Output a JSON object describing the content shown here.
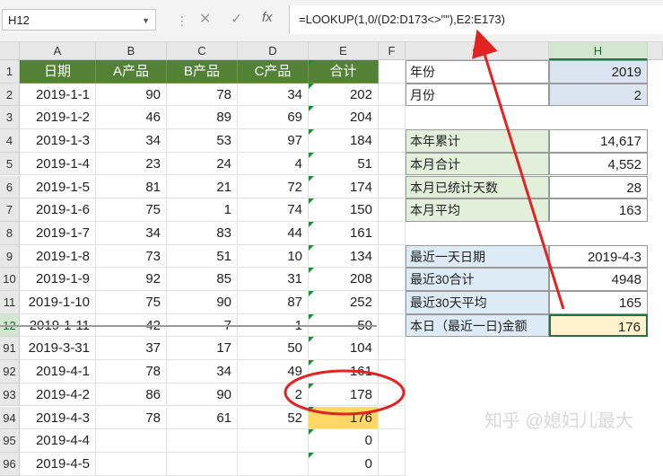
{
  "formula_bar": {
    "name_box": "H12",
    "cancel_icon": "cancel-x-icon",
    "confirm_icon": "confirm-check-icon",
    "function_label": "fx",
    "formula": "=LOOKUP(1,0/(D2:D173<>\"\"),E2:E173)"
  },
  "columns": [
    "A",
    "B",
    "C",
    "D",
    "E",
    "F",
    "G",
    "H"
  ],
  "header_row": [
    "日期",
    "A产品",
    "B产品",
    "C产品",
    "合计"
  ],
  "rows": [
    {
      "n": "1"
    },
    {
      "n": "2",
      "date": "2019-1-1",
      "a": "90",
      "b": "78",
      "c": "34",
      "t": "202"
    },
    {
      "n": "3",
      "date": "2019-1-2",
      "a": "46",
      "b": "89",
      "c": "69",
      "t": "204"
    },
    {
      "n": "4",
      "date": "2019-1-3",
      "a": "34",
      "b": "53",
      "c": "97",
      "t": "184"
    },
    {
      "n": "5",
      "date": "2019-1-4",
      "a": "23",
      "b": "24",
      "c": "4",
      "t": "51"
    },
    {
      "n": "6",
      "date": "2019-1-5",
      "a": "81",
      "b": "21",
      "c": "72",
      "t": "174"
    },
    {
      "n": "7",
      "date": "2019-1-6",
      "a": "75",
      "b": "1",
      "c": "74",
      "t": "150"
    },
    {
      "n": "8",
      "date": "2019-1-7",
      "a": "34",
      "b": "83",
      "c": "44",
      "t": "161"
    },
    {
      "n": "9",
      "date": "2019-1-8",
      "a": "73",
      "b": "51",
      "c": "10",
      "t": "134"
    },
    {
      "n": "10",
      "date": "2019-1-9",
      "a": "92",
      "b": "85",
      "c": "31",
      "t": "208"
    },
    {
      "n": "11",
      "date": "2019-1-10",
      "a": "75",
      "b": "90",
      "c": "87",
      "t": "252"
    },
    {
      "n": "12",
      "date": "2019-1-11",
      "a": "42",
      "b": "7",
      "c": "1",
      "t": "50"
    },
    {
      "n": "91",
      "date": "2019-3-31",
      "a": "37",
      "b": "17",
      "c": "50",
      "t": "104"
    },
    {
      "n": "92",
      "date": "2019-4-1",
      "a": "78",
      "b": "34",
      "c": "49",
      "t": "161"
    },
    {
      "n": "93",
      "date": "2019-4-2",
      "a": "86",
      "b": "90",
      "c": "2",
      "t": "178"
    },
    {
      "n": "94",
      "date": "2019-4-3",
      "a": "78",
      "b": "61",
      "c": "52",
      "t": "176"
    },
    {
      "n": "95",
      "date": "2019-4-4",
      "a": "",
      "b": "",
      "c": "",
      "t": "0"
    },
    {
      "n": "96",
      "date": "2019-4-5",
      "a": "",
      "b": "",
      "c": "",
      "t": "0"
    }
  ],
  "summary": {
    "year_label": "年份",
    "year": "2019",
    "month_label": "月份",
    "month": "2",
    "ytd_label": "本年累计",
    "ytd": "14,617",
    "month_total_label": "本月合计",
    "month_total": "4,552",
    "month_days_label": "本月已统计天数",
    "month_days": "28",
    "month_avg_label": "本月平均",
    "month_avg": "163",
    "last_date_label": "最近一天日期",
    "last_date": "2019-4-3",
    "last30_label": "最近30合计",
    "last30": "4948",
    "last30_avg_label": "最近30天平均",
    "last30_avg": "165",
    "today_label": "本日（最近一日)金额",
    "today": "176"
  },
  "watermark": "知乎 @媳妇儿最大",
  "colors": {
    "header_green": "#538135",
    "annotation_red": "#e02424",
    "highlight_yellow": "#ffd966"
  }
}
